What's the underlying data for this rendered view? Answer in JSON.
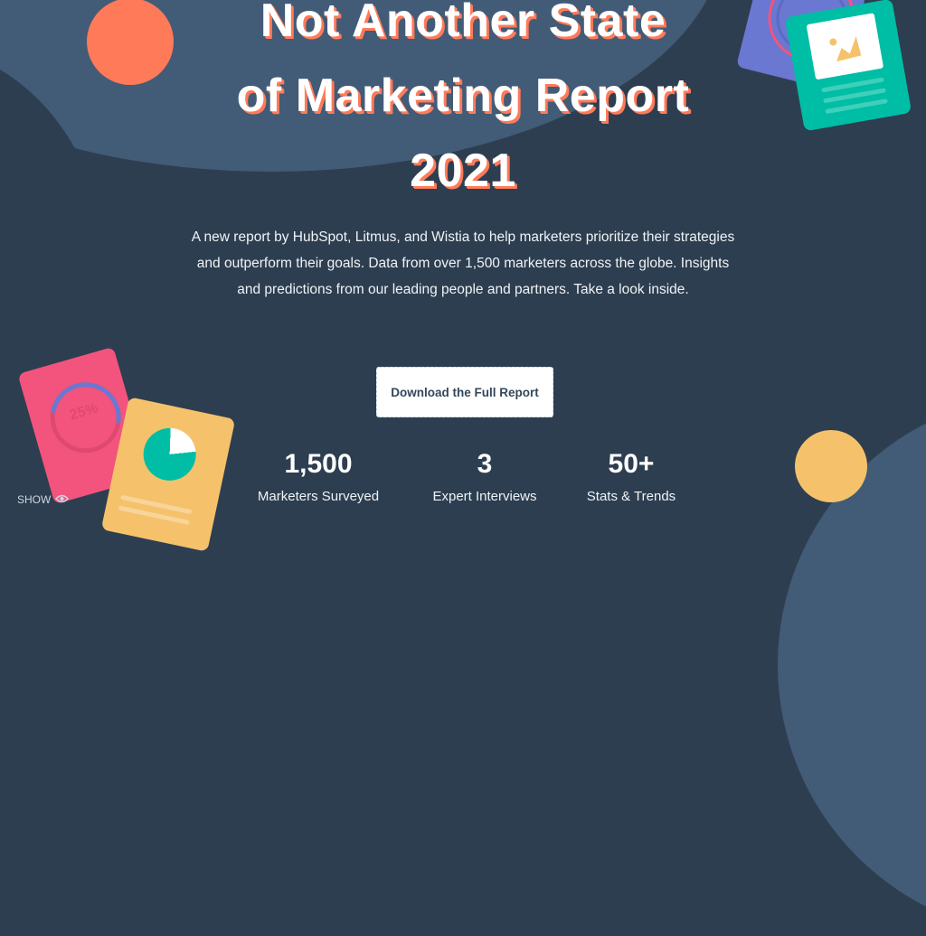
{
  "hero": {
    "title_lines": [
      "Not Another State",
      "of Marketing Report",
      "2021"
    ],
    "description": "A new report by HubSpot, Litmus, and Wistia to help marketers prioritize their strategies and outperform their goals. Data from over 1,500 marketers across the globe. Insights and predictions from our leading people and partners. Take a look inside.",
    "cta_label": "Download the Full Report"
  },
  "stats": [
    {
      "value": "1,500",
      "label": "Marketers Surveyed"
    },
    {
      "value": "3",
      "label": "Expert Interviews"
    },
    {
      "value": "50+",
      "label": "Stats & Trends"
    }
  ],
  "decor": {
    "pink_card_percent": "25%",
    "colors": {
      "background": "#2d3e50",
      "accent_coral": "#ff7a59",
      "teal": "#00bda5",
      "yellow": "#f5c26b",
      "pink": "#f2547d",
      "purple": "#6a78d1"
    }
  },
  "show_toggle": {
    "label": "SHOW",
    "icon": "eye-icon"
  }
}
